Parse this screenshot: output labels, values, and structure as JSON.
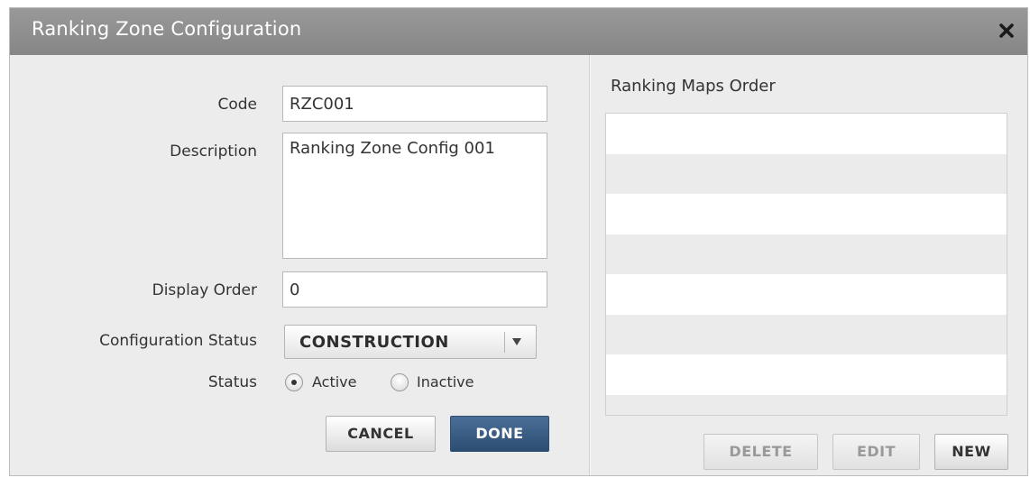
{
  "dialog": {
    "title": "Ranking Zone Configuration",
    "close_icon": "close-icon"
  },
  "form": {
    "code_label": "Code",
    "code_value": "RZC001",
    "description_label": "Description",
    "description_value": "Ranking Zone Config 001",
    "display_order_label": "Display Order",
    "display_order_value": "0",
    "configuration_status_label": "Configuration Status",
    "configuration_status_value": "CONSTRUCTION",
    "status_label": "Status",
    "status_options": [
      {
        "label": "Active",
        "selected": true
      },
      {
        "label": "Inactive",
        "selected": false
      }
    ],
    "cancel_label": "CANCEL",
    "done_label": "DONE"
  },
  "ranking_maps": {
    "title": "Ranking Maps Order",
    "rows": [
      "",
      "",
      "",
      "",
      "",
      "",
      ""
    ],
    "delete_label": "DELETE",
    "edit_label": "EDIT",
    "new_label": "NEW"
  },
  "colors": {
    "titlebar": "#8e8e8e",
    "primary_button": "#3a5d84",
    "dialog_background": "#ececec"
  }
}
